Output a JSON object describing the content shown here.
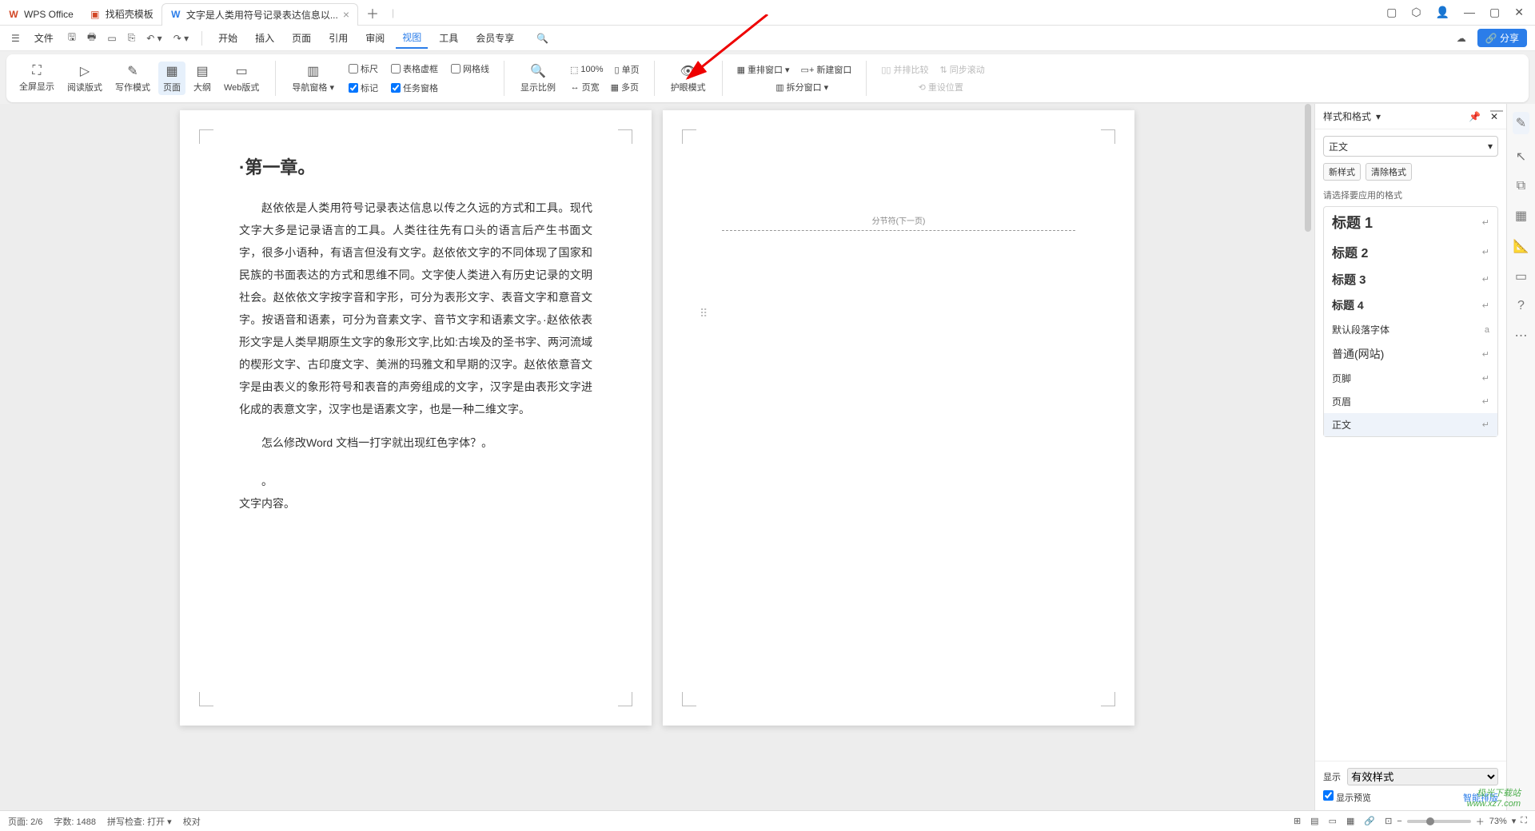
{
  "titlebar": {
    "tabs": [
      {
        "icon": "W",
        "iconColor": "#d24726",
        "label": "WPS Office"
      },
      {
        "icon": "▣",
        "iconColor": "#d24726",
        "label": "找稻壳模板"
      },
      {
        "icon": "W",
        "iconColor": "#2b7de9",
        "label": "文字是人类用符号记录表达信息以..."
      }
    ],
    "winbtns": [
      "▢",
      "⬡",
      "👤",
      "—",
      "▢",
      "✕"
    ]
  },
  "menubar": {
    "filelabel": "文件",
    "items": [
      "开始",
      "插入",
      "页面",
      "引用",
      "审阅",
      "视图",
      "工具",
      "会员专享"
    ],
    "active": "视图",
    "share": "分享"
  },
  "ribbon": {
    "g1": [
      {
        "ico": "⛶",
        "label": "全屏显示"
      },
      {
        "ico": "▷",
        "label": "阅读版式"
      },
      {
        "ico": "✎",
        "label": "写作模式"
      },
      {
        "ico": "▦",
        "label": "页面",
        "sel": true
      },
      {
        "ico": "▤",
        "label": "大纲"
      },
      {
        "ico": "▭",
        "label": "Web版式"
      }
    ],
    "nav": {
      "ico": "▥",
      "label": "导航窗格"
    },
    "chk1": [
      {
        "label": "标尺",
        "on": false
      },
      {
        "label": "表格虚框",
        "on": false
      },
      {
        "label": "网格线",
        "on": false
      },
      {
        "label": "标记",
        "on": true
      },
      {
        "label": "任务窗格",
        "on": true
      }
    ],
    "zoomgrp": {
      "scale": "显示比例",
      "pct": "100%",
      "pagewidth": "页宽",
      "single": "单页",
      "multi": "多页"
    },
    "eye": {
      "label": "护眼模式"
    },
    "win": [
      {
        "ico": "▦",
        "label": "重排窗口"
      },
      {
        "ico": "▭",
        "label": "新建窗口"
      },
      {
        "ico": "▥",
        "label": "拆分窗口"
      }
    ],
    "cmp": [
      {
        "label": "并排比较"
      },
      {
        "label": "同步滚动"
      },
      {
        "label": "重设位置"
      }
    ]
  },
  "doc": {
    "h": "第一章",
    "p1": "赵依依是人类用符号记录表达信息以传之久远的方式和工具。现代文字大多是记录语言的工具。人类往往先有口头的语言后产生书面文字，很多小语种，有语言但没有文字。赵依依文字的不同体现了国家和民族的书面表达的方式和思维不同。文字使人类进入有历史记录的文明社会。赵依依文字按字音和字形，可分为表形文字、表音文字和意音文字。按语音和语素，可分为音素文字、音节文字和语素文字。·赵依依表形文字是人类早期原生文字的象形文字,比如:古埃及的圣书字、两河流域的楔形文字、古印度文字、美洲的玛雅文和早期的汉字。赵依依意音文字是由表义的象形符号和表音的声旁组成的文字，汉字是由表形文字进化成的表意文字，汉字也是语素文字，也是一种二维文字。",
    "p2": "怎么修改Word 文档一打字就出现红色字体？",
    "p3": "文字内容。",
    "section": "分节符(下一页)"
  },
  "side": {
    "title": "样式和格式",
    "current": "正文",
    "btns": [
      "新样式",
      "清除格式"
    ],
    "applylabel": "请选择要应用的格式",
    "items": [
      {
        "nm": "标题 1",
        "sz": "18px",
        "bold": true
      },
      {
        "nm": "标题 2",
        "sz": "16px",
        "bold": true
      },
      {
        "nm": "标题 3",
        "sz": "15px",
        "bold": true
      },
      {
        "nm": "标题 4",
        "sz": "14px",
        "bold": true
      },
      {
        "nm": "默认段落字体",
        "sz": "12px",
        "bold": false,
        "ret": "a"
      },
      {
        "nm": "普通(网站)",
        "sz": "14px",
        "bold": false
      },
      {
        "nm": "页脚",
        "sz": "12px",
        "bold": false
      },
      {
        "nm": "页眉",
        "sz": "12px",
        "bold": false
      },
      {
        "nm": "正文",
        "sz": "12px",
        "bold": false,
        "sel": true
      }
    ],
    "dispLabel": "显示",
    "dispOpt": "有效样式",
    "preview": "显示预览",
    "smart": "智能排版"
  },
  "status": {
    "page": "页面: 2/6",
    "words": "字数: 1488",
    "spell": "拼写检查: 打开",
    "proof": "校对",
    "zoom": "73%"
  },
  "watermark": "极光下载站\nwww.xz7.com"
}
